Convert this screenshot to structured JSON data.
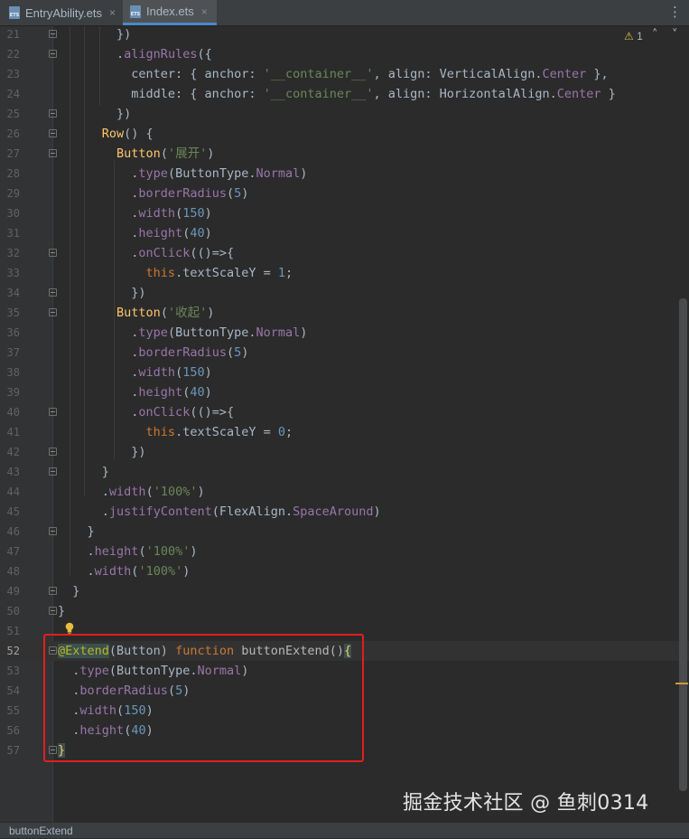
{
  "tabs": [
    {
      "label": "EntryAbility.ets",
      "close": "×",
      "icon": "ets-file-icon"
    },
    {
      "label": "Index.ets",
      "close": "×",
      "icon": "ets-file-icon"
    }
  ],
  "menu_glyph": "⋮",
  "inspection": {
    "glyph": "⚠",
    "count": "1",
    "up": "˄",
    "down": "˅"
  },
  "colors": {
    "accent": "#4a88c7",
    "highlight_box": "#e0201b",
    "warning": "#d6bf55",
    "keyword": "#cc7832",
    "function": "#ffc66d",
    "property": "#9876aa",
    "string": "#6a8759",
    "number": "#6897bb",
    "annotation": "#bbb529",
    "text": "#a9b7c6",
    "param": "#b8b8b8"
  },
  "code_lines": [
    {
      "n": "21",
      "fold": true,
      "cur": false,
      "tokens": [
        [
          "        ",
          ""
        ],
        [
          "})",
          ""
        ]
      ]
    },
    {
      "n": "22",
      "fold": true,
      "cur": false,
      "tokens": [
        [
          "        ",
          ""
        ],
        [
          ".",
          ""
        ],
        [
          "alignRules",
          "p"
        ],
        [
          "({",
          ""
        ]
      ]
    },
    {
      "n": "23",
      "fold": false,
      "cur": false,
      "tokens": [
        [
          "          ",
          ""
        ],
        [
          "center: { anchor: ",
          ""
        ],
        [
          "'__container__'",
          "s"
        ],
        [
          ", align: VerticalAlign.",
          ""
        ],
        [
          "Center",
          "k0"
        ],
        [
          " },",
          ""
        ]
      ]
    },
    {
      "n": "24",
      "fold": false,
      "cur": false,
      "tokens": [
        [
          "          ",
          ""
        ],
        [
          "middle: { anchor: ",
          ""
        ],
        [
          "'__container__'",
          "s"
        ],
        [
          ", align: HorizontalAlign.",
          ""
        ],
        [
          "Center",
          "k0"
        ],
        [
          " }",
          ""
        ]
      ]
    },
    {
      "n": "25",
      "fold": true,
      "cur": false,
      "tokens": [
        [
          "        ",
          ""
        ],
        [
          "})",
          ""
        ]
      ]
    },
    {
      "n": "26",
      "fold": true,
      "cur": false,
      "tokens": [
        [
          "      ",
          ""
        ],
        [
          "Row",
          "f"
        ],
        [
          "() {",
          ""
        ]
      ]
    },
    {
      "n": "27",
      "fold": true,
      "cur": false,
      "tokens": [
        [
          "        ",
          ""
        ],
        [
          "Button",
          "f"
        ],
        [
          "(",
          ""
        ],
        [
          "'展开'",
          "s"
        ],
        [
          ")",
          ""
        ]
      ]
    },
    {
      "n": "28",
      "fold": false,
      "cur": false,
      "tokens": [
        [
          "          ",
          ""
        ],
        [
          ".",
          ""
        ],
        [
          "type",
          "p"
        ],
        [
          "(ButtonType.",
          ""
        ],
        [
          "Normal",
          "k0"
        ],
        [
          ")",
          ""
        ]
      ]
    },
    {
      "n": "29",
      "fold": false,
      "cur": false,
      "tokens": [
        [
          "          ",
          ""
        ],
        [
          ".",
          ""
        ],
        [
          "borderRadius",
          "p"
        ],
        [
          "(",
          ""
        ],
        [
          "5",
          "n"
        ],
        [
          ")",
          ""
        ]
      ]
    },
    {
      "n": "30",
      "fold": false,
      "cur": false,
      "tokens": [
        [
          "          ",
          ""
        ],
        [
          ".",
          ""
        ],
        [
          "width",
          "p"
        ],
        [
          "(",
          ""
        ],
        [
          "150",
          "n"
        ],
        [
          ")",
          ""
        ]
      ]
    },
    {
      "n": "31",
      "fold": false,
      "cur": false,
      "tokens": [
        [
          "          ",
          ""
        ],
        [
          ".",
          ""
        ],
        [
          "height",
          "p"
        ],
        [
          "(",
          ""
        ],
        [
          "40",
          "n"
        ],
        [
          ")",
          ""
        ]
      ]
    },
    {
      "n": "32",
      "fold": true,
      "cur": false,
      "tokens": [
        [
          "          ",
          ""
        ],
        [
          ".",
          ""
        ],
        [
          "onClick",
          "p"
        ],
        [
          "(()=>{",
          ""
        ]
      ]
    },
    {
      "n": "33",
      "fold": false,
      "cur": false,
      "tokens": [
        [
          "            ",
          ""
        ],
        [
          "this",
          "k"
        ],
        [
          ".textScaleY = ",
          ""
        ],
        [
          "1",
          "n"
        ],
        [
          ";",
          ""
        ]
      ]
    },
    {
      "n": "34",
      "fold": true,
      "cur": false,
      "tokens": [
        [
          "          ",
          ""
        ],
        [
          "})",
          ""
        ]
      ]
    },
    {
      "n": "35",
      "fold": true,
      "cur": false,
      "tokens": [
        [
          "        ",
          ""
        ],
        [
          "Button",
          "f"
        ],
        [
          "(",
          ""
        ],
        [
          "'收起'",
          "s"
        ],
        [
          ")",
          ""
        ]
      ]
    },
    {
      "n": "36",
      "fold": false,
      "cur": false,
      "tokens": [
        [
          "          ",
          ""
        ],
        [
          ".",
          ""
        ],
        [
          "type",
          "p"
        ],
        [
          "(ButtonType.",
          ""
        ],
        [
          "Normal",
          "k0"
        ],
        [
          ")",
          ""
        ]
      ]
    },
    {
      "n": "37",
      "fold": false,
      "cur": false,
      "tokens": [
        [
          "          ",
          ""
        ],
        [
          ".",
          ""
        ],
        [
          "borderRadius",
          "p"
        ],
        [
          "(",
          ""
        ],
        [
          "5",
          "n"
        ],
        [
          ")",
          ""
        ]
      ]
    },
    {
      "n": "38",
      "fold": false,
      "cur": false,
      "tokens": [
        [
          "          ",
          ""
        ],
        [
          ".",
          ""
        ],
        [
          "width",
          "p"
        ],
        [
          "(",
          ""
        ],
        [
          "150",
          "n"
        ],
        [
          ")",
          ""
        ]
      ]
    },
    {
      "n": "39",
      "fold": false,
      "cur": false,
      "tokens": [
        [
          "          ",
          ""
        ],
        [
          ".",
          ""
        ],
        [
          "height",
          "p"
        ],
        [
          "(",
          ""
        ],
        [
          "40",
          "n"
        ],
        [
          ")",
          ""
        ]
      ]
    },
    {
      "n": "40",
      "fold": true,
      "cur": false,
      "tokens": [
        [
          "          ",
          ""
        ],
        [
          ".",
          ""
        ],
        [
          "onClick",
          "p"
        ],
        [
          "(()=>{",
          ""
        ]
      ]
    },
    {
      "n": "41",
      "fold": false,
      "cur": false,
      "tokens": [
        [
          "            ",
          ""
        ],
        [
          "this",
          "k"
        ],
        [
          ".textScaleY = ",
          ""
        ],
        [
          "0",
          "n"
        ],
        [
          ";",
          ""
        ]
      ]
    },
    {
      "n": "42",
      "fold": true,
      "cur": false,
      "tokens": [
        [
          "          ",
          ""
        ],
        [
          "})",
          ""
        ]
      ]
    },
    {
      "n": "43",
      "fold": true,
      "cur": false,
      "tokens": [
        [
          "      ",
          ""
        ],
        [
          "}",
          ""
        ]
      ]
    },
    {
      "n": "44",
      "fold": false,
      "cur": false,
      "tokens": [
        [
          "      ",
          ""
        ],
        [
          ".",
          ""
        ],
        [
          "width",
          "p"
        ],
        [
          "(",
          ""
        ],
        [
          "'100%'",
          "s"
        ],
        [
          ")",
          ""
        ]
      ]
    },
    {
      "n": "45",
      "fold": false,
      "cur": false,
      "tokens": [
        [
          "      ",
          ""
        ],
        [
          ".",
          ""
        ],
        [
          "justifyContent",
          "p"
        ],
        [
          "(FlexAlign.",
          ""
        ],
        [
          "SpaceAround",
          "k0"
        ],
        [
          ")",
          ""
        ]
      ]
    },
    {
      "n": "46",
      "fold": true,
      "cur": false,
      "tokens": [
        [
          "    ",
          ""
        ],
        [
          "}",
          ""
        ]
      ]
    },
    {
      "n": "47",
      "fold": false,
      "cur": false,
      "tokens": [
        [
          "    ",
          ""
        ],
        [
          ".",
          ""
        ],
        [
          "height",
          "p"
        ],
        [
          "(",
          ""
        ],
        [
          "'100%'",
          "s"
        ],
        [
          ")",
          ""
        ]
      ]
    },
    {
      "n": "48",
      "fold": false,
      "cur": false,
      "tokens": [
        [
          "    ",
          ""
        ],
        [
          ".",
          ""
        ],
        [
          "width",
          "p"
        ],
        [
          "(",
          ""
        ],
        [
          "'100%'",
          "s"
        ],
        [
          ")",
          ""
        ]
      ]
    },
    {
      "n": "49",
      "fold": true,
      "cur": false,
      "tokens": [
        [
          "  ",
          ""
        ],
        [
          "}",
          ""
        ]
      ]
    },
    {
      "n": "50",
      "fold": true,
      "cur": false,
      "tokens": [
        [
          "}",
          ""
        ]
      ]
    },
    {
      "n": "51",
      "fold": false,
      "cur": false,
      "tokens": []
    },
    {
      "n": "52",
      "fold": true,
      "cur": true,
      "tokens": [
        [
          "@Extend",
          "a"
        ],
        [
          "(Button) ",
          ""
        ],
        [
          "function",
          "k"
        ],
        [
          " ",
          ""
        ],
        [
          "buttonExtend",
          "g"
        ],
        [
          "()",
          ""
        ],
        [
          "{",
          "b"
        ]
      ]
    },
    {
      "n": "53",
      "fold": false,
      "cur": false,
      "tokens": [
        [
          "  ",
          ""
        ],
        [
          ".",
          ""
        ],
        [
          "type",
          "p"
        ],
        [
          "(ButtonType.",
          ""
        ],
        [
          "Normal",
          "k0"
        ],
        [
          ")",
          ""
        ]
      ]
    },
    {
      "n": "54",
      "fold": false,
      "cur": false,
      "tokens": [
        [
          "  ",
          ""
        ],
        [
          ".",
          ""
        ],
        [
          "borderRadius",
          "p"
        ],
        [
          "(",
          ""
        ],
        [
          "5",
          "n"
        ],
        [
          ")",
          ""
        ]
      ]
    },
    {
      "n": "55",
      "fold": false,
      "cur": false,
      "tokens": [
        [
          "  ",
          ""
        ],
        [
          ".",
          ""
        ],
        [
          "width",
          "p"
        ],
        [
          "(",
          ""
        ],
        [
          "150",
          "n"
        ],
        [
          ")",
          ""
        ]
      ]
    },
    {
      "n": "56",
      "fold": false,
      "cur": false,
      "tokens": [
        [
          "  ",
          ""
        ],
        [
          ".",
          ""
        ],
        [
          "height",
          "p"
        ],
        [
          "(",
          ""
        ],
        [
          "40",
          "n"
        ],
        [
          ")",
          ""
        ]
      ]
    },
    {
      "n": "57",
      "fold": true,
      "cur": false,
      "tokens": [
        [
          "}",
          "b"
        ]
      ]
    }
  ],
  "watermark": "掘金技术社区 @ 鱼刺0314",
  "status_text": "buttonExtend"
}
